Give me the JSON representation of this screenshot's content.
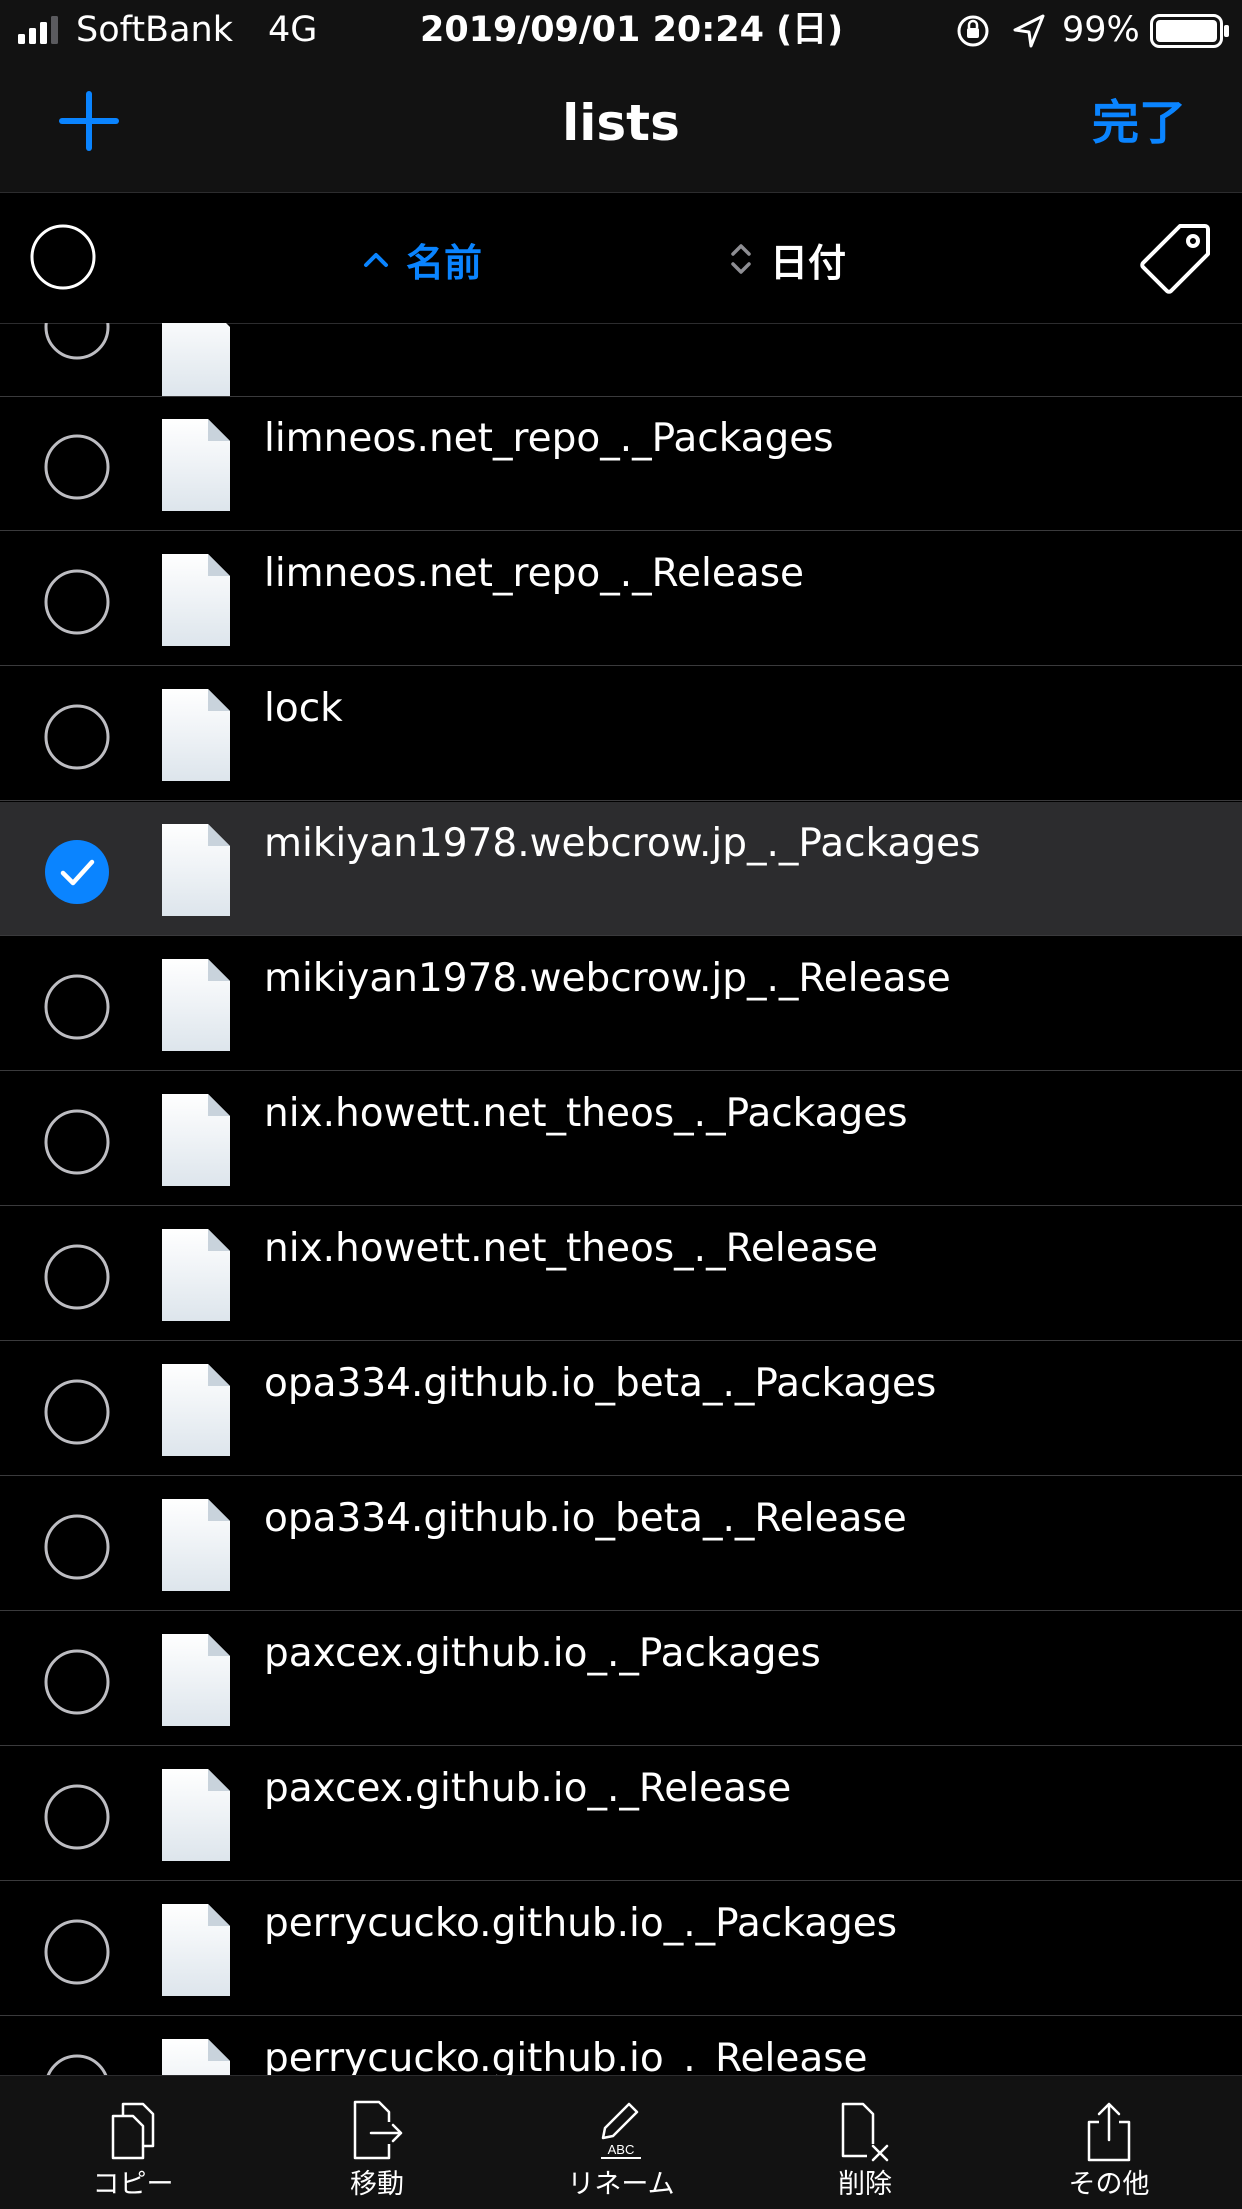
{
  "status_bar": {
    "carrier": "SoftBank",
    "network": "4G",
    "datetime": "2019/09/01 20:24 (日)",
    "battery": "99%"
  },
  "nav": {
    "title": "lists",
    "done_label": "完了"
  },
  "sort": {
    "name_label": "名前",
    "date_label": "日付",
    "active": "name",
    "direction": "ascending"
  },
  "files": [
    {
      "name": "limneos.net_repo_._Packages",
      "selected": false
    },
    {
      "name": "limneos.net_repo_._Release",
      "selected": false
    },
    {
      "name": "lock",
      "selected": false
    },
    {
      "name": "mikiyan1978.webcrow.jp_._Packages",
      "selected": true
    },
    {
      "name": "mikiyan1978.webcrow.jp_._Release",
      "selected": false
    },
    {
      "name": "nix.howett.net_theos_._Packages",
      "selected": false
    },
    {
      "name": "nix.howett.net_theos_._Release",
      "selected": false
    },
    {
      "name": "opa334.github.io_beta_._Packages",
      "selected": false
    },
    {
      "name": "opa334.github.io_beta_._Release",
      "selected": false
    },
    {
      "name": "paxcex.github.io_._Packages",
      "selected": false
    },
    {
      "name": "paxcex.github.io_._Release",
      "selected": false
    },
    {
      "name": "perrycucko.github.io_._Packages",
      "selected": false
    },
    {
      "name": "perrycucko.github.io_._Release",
      "selected": false
    }
  ],
  "toolbar": {
    "copy_label": "コピー",
    "move_label": "移動",
    "rename_label": "リネーム",
    "delete_label": "削除",
    "more_label": "その他"
  },
  "colors": {
    "accent": "#0a84ff",
    "selected_row": "#2c2c2e",
    "background": "#000000"
  }
}
